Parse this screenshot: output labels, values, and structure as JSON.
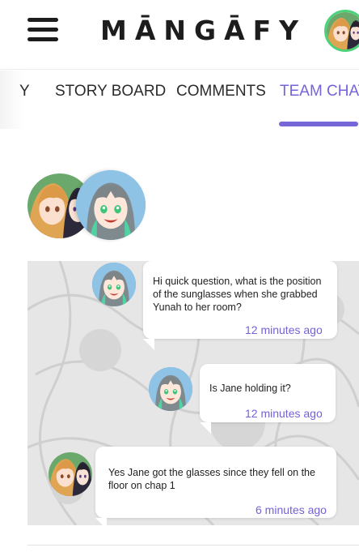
{
  "app": {
    "logo": "MĀNGĀFY"
  },
  "tabs": [
    {
      "label": "Y"
    },
    {
      "label": "STORY BOARD"
    },
    {
      "label": "COMMENTS"
    },
    {
      "label": "TEAM CHAT",
      "active": true
    }
  ],
  "colors": {
    "accent": "#7564d8",
    "avatar_ring": "#4cd37a"
  },
  "messages": [
    {
      "text": "Hi quick question, what is the position of the sunglasses when she grabbed Yunah to her room?",
      "time": "12 minutes ago",
      "avatar": "green-hair-character-avatar"
    },
    {
      "text": "Is Jane holding it?",
      "time": "12 minutes ago",
      "avatar": "green-hair-character-avatar"
    },
    {
      "text": "Yes Jane got the glasses since they fell on the floor on chap 1",
      "time": "6 minutes ago",
      "avatar": "blonde-duo-character-avatar"
    }
  ]
}
